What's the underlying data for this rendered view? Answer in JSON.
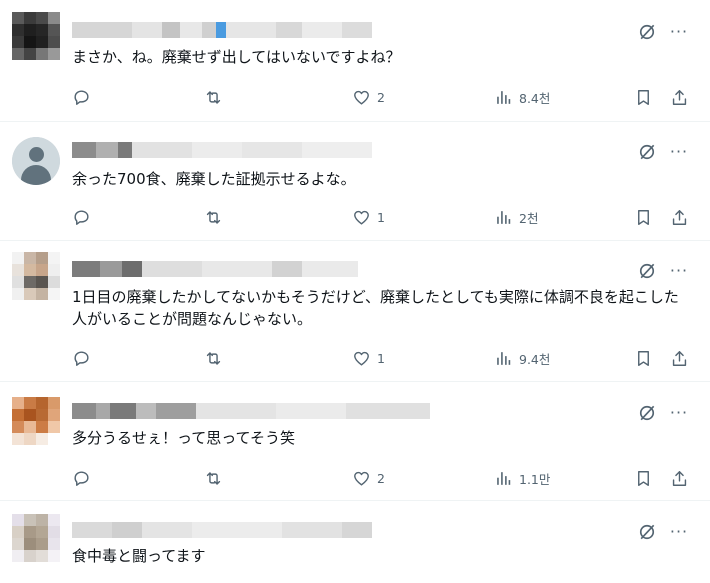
{
  "replies": [
    {
      "text": "まさか、ね。廃棄せず出してはいないですよね？",
      "likes": "2",
      "views": "8.4천"
    },
    {
      "text": "余った700食、廃棄した証拠示せるよな。",
      "likes": "1",
      "views": "2천"
    },
    {
      "text": "1日目の廃棄したかしてないかもそうだけど、廃棄したとしても実際に体調不良を起こした人がいることが問題なんじゃない。",
      "likes": "1",
      "views": "9.4천"
    },
    {
      "text": "多分うるせぇ！って思ってそう笑",
      "likes": "2",
      "views": "1.1만"
    },
    {
      "text": "食中毒と闘ってます"
    }
  ],
  "icons": {
    "reply": "reply-icon",
    "repost": "repost-icon",
    "like": "heart-icon",
    "views": "views-chart-icon",
    "bookmark": "bookmark-icon",
    "share": "share-icon",
    "grok": "grok-icon",
    "more": "more-icon"
  },
  "colors": {
    "icon": "#536471",
    "text": "#0f1419",
    "divider": "#eff3f4"
  }
}
